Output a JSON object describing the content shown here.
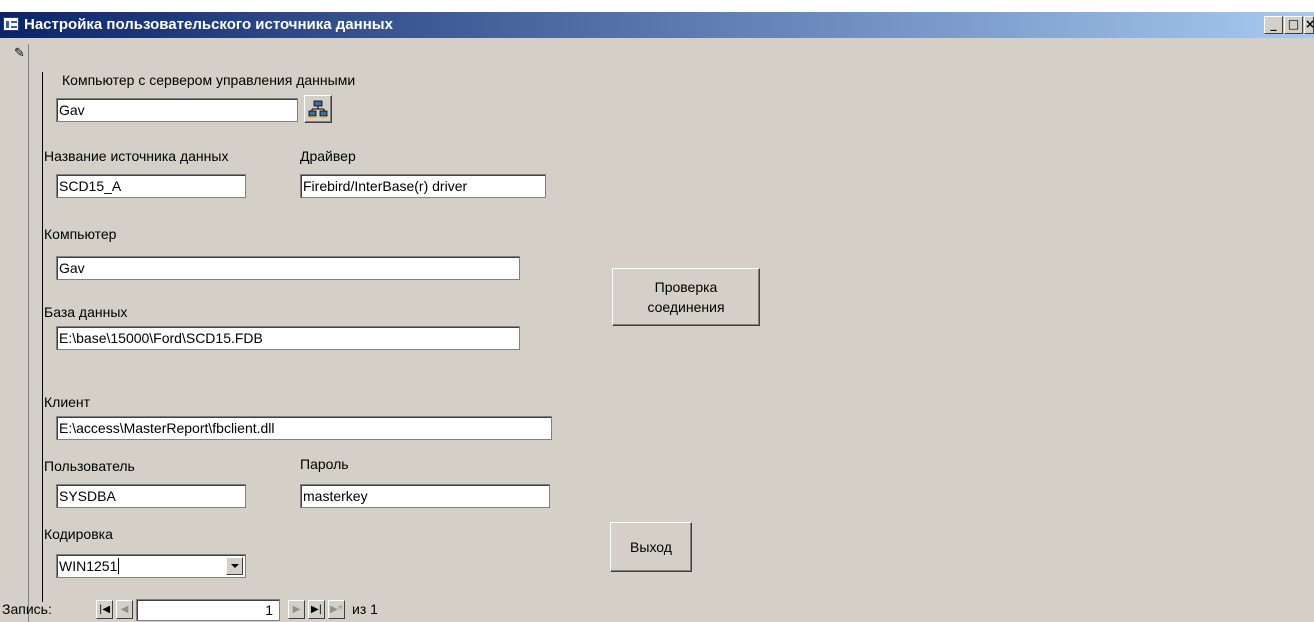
{
  "window": {
    "title": "Настройка пользовательского источника данных",
    "minimize": "_",
    "maximize": "□",
    "close": "×"
  },
  "form": {
    "server_computer_label": "Компьютер с сервером управления данными",
    "server_computer_value": "Gav",
    "dsn_label": "Название источника данных",
    "dsn_value": "SCD15_A",
    "driver_label": "Драйвер",
    "driver_value": "Firebird/InterBase(r) driver",
    "computer_label": "Компьютер",
    "computer_value": "Gav",
    "database_label": "База данных",
    "database_value": "E:\\base\\15000\\Ford\\SCD15.FDB",
    "client_label": "Клиент",
    "client_value": "E:\\access\\MasterReport\\fbclient.dll",
    "user_label": "Пользователь",
    "user_value": "SYSDBA",
    "password_label": "Пароль",
    "password_value": "masterkey",
    "encoding_label": "Кодировка",
    "encoding_value": "WIN1251",
    "test_connection_line1": "Проверка",
    "test_connection_line2": "соединения",
    "exit_label": "Выход"
  },
  "record_nav": {
    "label": "Запись:",
    "current": "1",
    "of_text": "из  1",
    "first": "|◀",
    "prev": "◀",
    "next": "▶",
    "last": "▶|",
    "new": "▶*"
  },
  "icons": {
    "title": "form-icon",
    "pencil": "pencil-icon",
    "browse": "network-computers-icon"
  }
}
